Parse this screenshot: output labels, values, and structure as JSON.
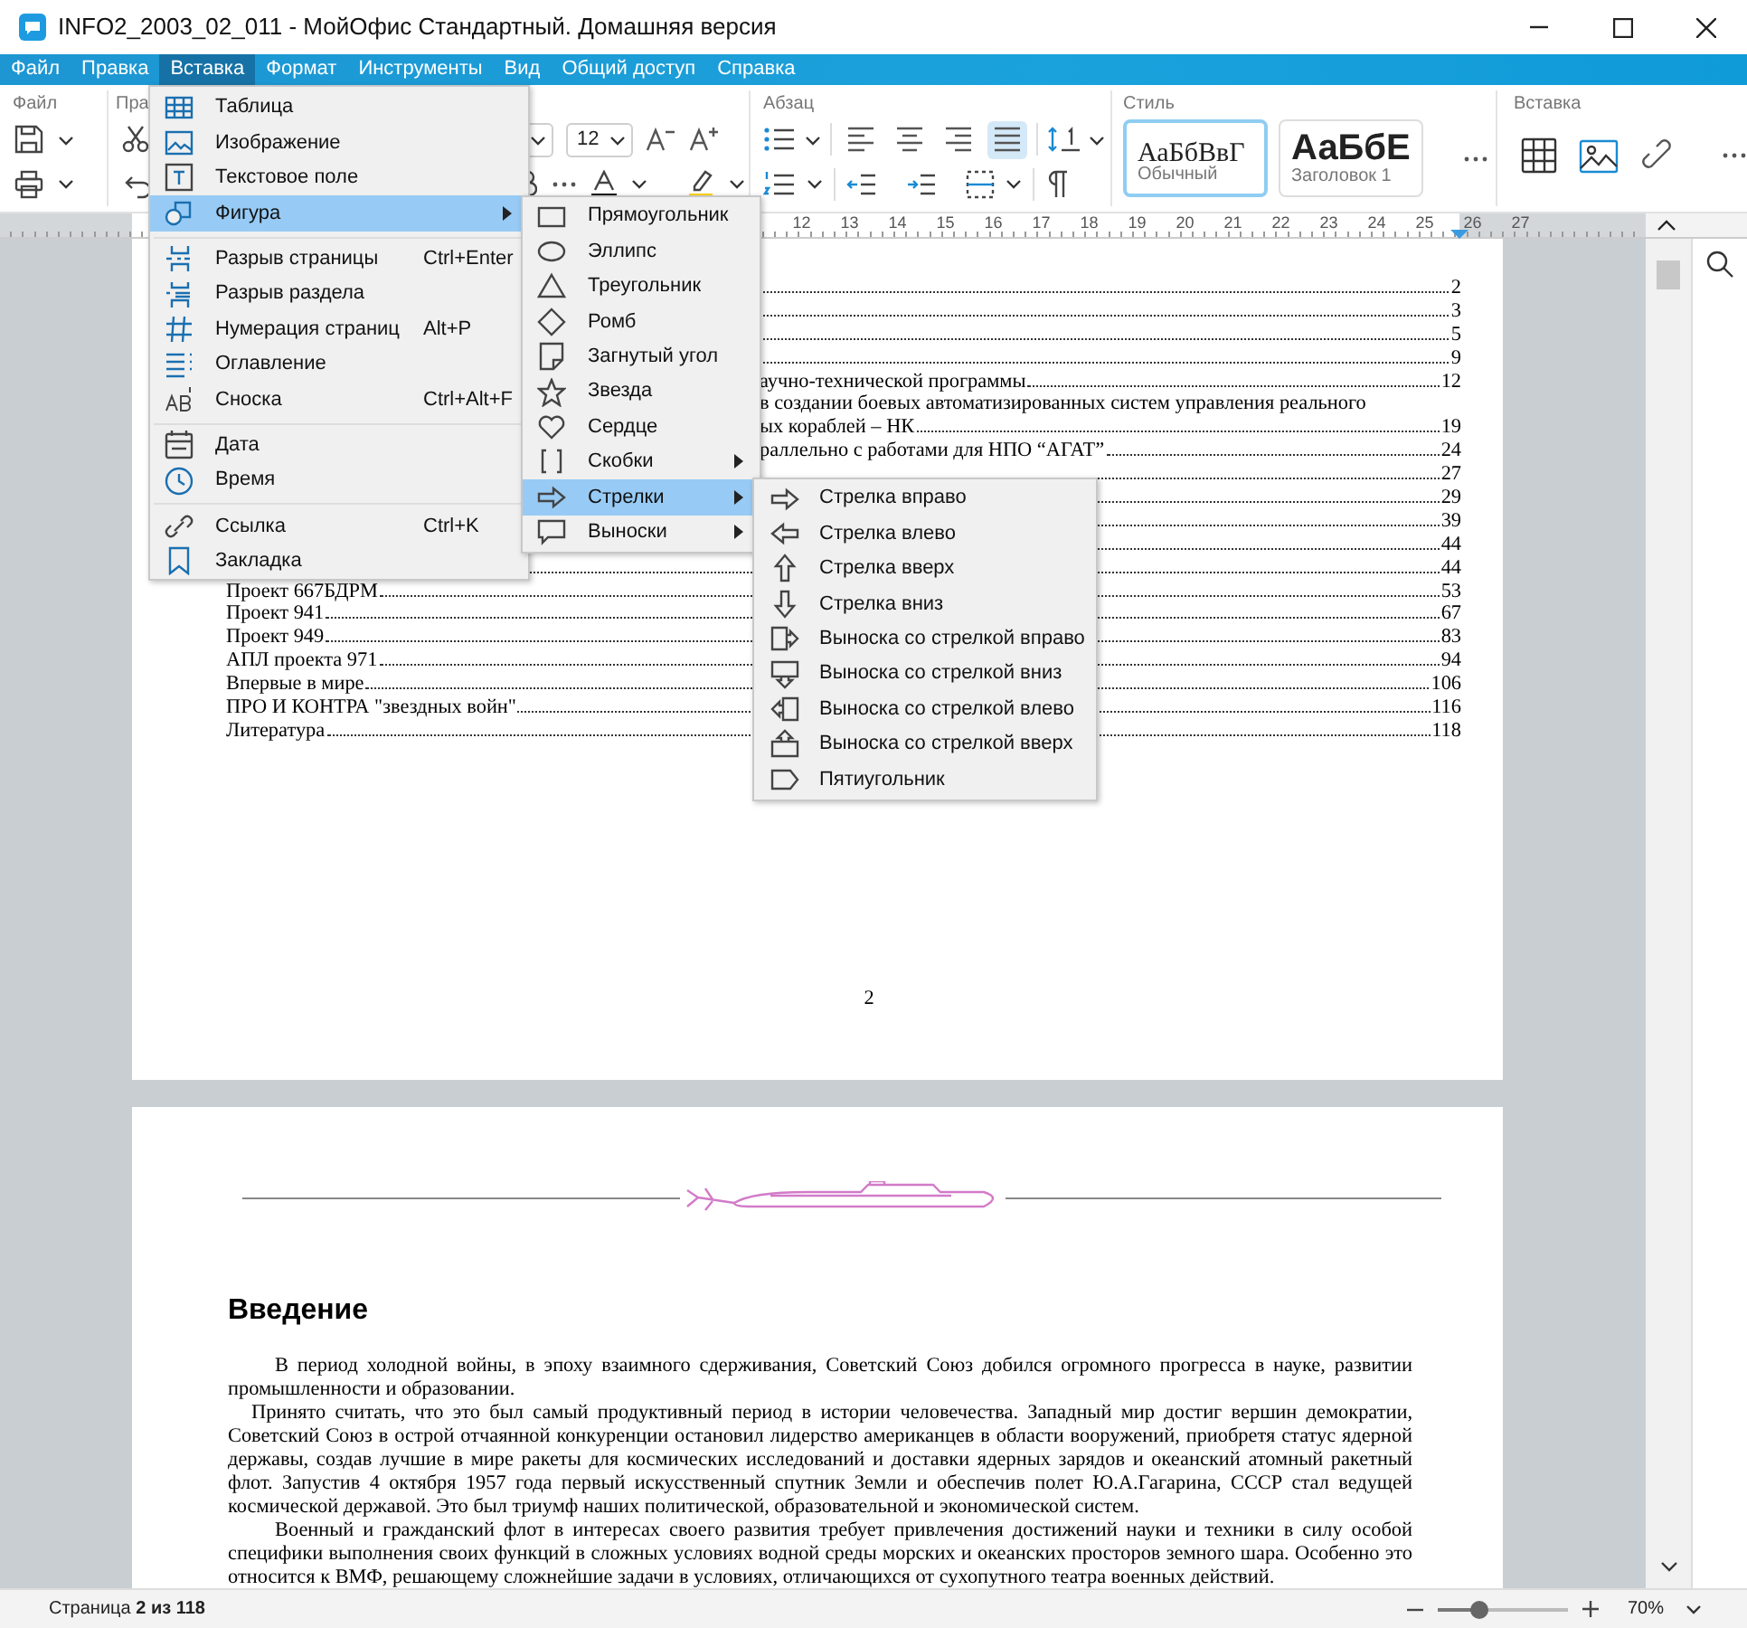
{
  "window": {
    "title": "INFO2_2003_02_011 - МойОфис Стандартный. Домашняя версия"
  },
  "menu_bar": [
    {
      "label": "Файл",
      "selected": false
    },
    {
      "label": "Правка",
      "selected": false
    },
    {
      "label": "Вставка",
      "selected": true
    },
    {
      "label": "Формат",
      "selected": false
    },
    {
      "label": "Инструменты",
      "selected": false
    },
    {
      "label": "Вид",
      "selected": false
    },
    {
      "label": "Общий доступ",
      "selected": false
    },
    {
      "label": "Справка",
      "selected": false
    }
  ],
  "ribbon": {
    "file_label": "Файл",
    "edit_label": "Пра",
    "font_size": "12",
    "paragraph_label": "Абзац",
    "alignment": [
      {
        "selected": false
      },
      {
        "selected": false
      },
      {
        "selected": false
      },
      {
        "selected": true
      }
    ],
    "style_label": "Стиль",
    "styles": [
      {
        "kind": "normal",
        "sample": "АаБбВвГ",
        "name": "Обычный",
        "selected": true
      },
      {
        "kind": "heading",
        "sample": "АаБбЕ",
        "name": "Заголовок 1",
        "selected": false
      }
    ],
    "insert_label": "Вставка"
  },
  "ruler": {
    "numbers": [
      "12",
      "13",
      "14",
      "15",
      "16",
      "17",
      "18",
      "19",
      "20",
      "21",
      "22",
      "23",
      "24",
      "25",
      "26",
      "27"
    ]
  },
  "document": {
    "toc": [
      {
        "kind": "covered",
        "page": "2"
      },
      {
        "kind": "covered",
        "page": "3"
      },
      {
        "kind": "covered",
        "page": "5"
      },
      {
        "kind": "covered",
        "page": "9"
      },
      {
        "kind": "partial",
        "text": "аучно-технической программы",
        "page": "12"
      },
      {
        "kind": "partial",
        "text": "в создании боевых автоматизированных систем управления  реального"
      },
      {
        "kind": "partial",
        "text": "ых кораблей – НК",
        "page": "19"
      },
      {
        "kind": "partial",
        "text": "раллельно с работами для НПО “АГАТ”",
        "page": "24"
      },
      {
        "kind": "covered",
        "page": "27"
      },
      {
        "kind": "covered",
        "page": "29"
      },
      {
        "kind": "covered",
        "page": "39"
      },
      {
        "kind": "covered",
        "page": "44"
      },
      {
        "kind": "covered",
        "page": "44"
      },
      {
        "kind": "full",
        "text": "Проект 667БДРМ",
        "page": "53"
      },
      {
        "kind": "full",
        "text": "Проект 941",
        "page": "67"
      },
      {
        "kind": "full",
        "text": "Проект 949",
        "page": "83"
      },
      {
        "kind": "full",
        "text": "АПЛ проекта 971",
        "page": "94"
      },
      {
        "kind": "full",
        "text": "Впервые в мире",
        "page": "106"
      },
      {
        "kind": "full",
        "text": "ПРО И КОНТРА \"звездных войн\"",
        "page": "116"
      },
      {
        "kind": "full",
        "text": "Литература",
        "page": "118"
      }
    ],
    "page_number": "2",
    "heading": "Введение",
    "paragraphs": [
      {
        "kind": "indent",
        "text": "В период холодной войны, в эпоху взаимного сдерживания, Советский Союз добился огромного прогресса в науке, развитии промышленности и образовании."
      },
      {
        "kind": "short_indent",
        "text": "Принято считать, что это был самый продуктивный период в истории человечества. Западный мир достиг вершин демократии, Советский Союз в острой отчаянной конкуренции остановил лидерство американцев в области вооружений, приобретя статус ядерной державы, создав лучшие в мире ракеты для космических исследований и доставки ядерных зарядов и океанский атомный ракетный флот. Запустив 4 октября 1957 года первый искусственный спутник Земли и обеспечив полет Ю.А.Гагарина, СССР стал ведущей космической державой. Это был триумф наших политической, образовательной и экономической систем."
      },
      {
        "kind": "indent",
        "text": "Военный и гражданский флот в интересах своего развития требует привлечения достижений науки и техники в силу особой специфики выполнения своих функций в сложных условиях водной среды морских и океанских просторов земного шара. Особенно это относится к ВМФ, решающему сложнейшие задачи в условиях, отличающихся от сухопутного театра военных действий."
      }
    ]
  },
  "insert_menu": {
    "items": [
      {
        "kind": "item",
        "label": "Таблица",
        "selected": false,
        "submenu": false
      },
      {
        "kind": "item",
        "label": "Изображение",
        "selected": false,
        "submenu": false
      },
      {
        "kind": "item",
        "label": "Текстовое поле",
        "selected": false,
        "submenu": false
      },
      {
        "kind": "item",
        "label": "Фигура",
        "selected": true,
        "submenu": true
      },
      {
        "kind": "separator"
      },
      {
        "kind": "item",
        "label": "Разрыв страницы",
        "shortcut": "Ctrl+Enter",
        "selected": false,
        "submenu": false
      },
      {
        "kind": "item",
        "label": "Разрыв раздела",
        "selected": false,
        "submenu": false
      },
      {
        "kind": "item",
        "label": "Нумерация страниц",
        "shortcut": "Alt+P",
        "selected": false,
        "submenu": false
      },
      {
        "kind": "item",
        "label": "Оглавление",
        "selected": false,
        "submenu": false
      },
      {
        "kind": "item",
        "label": "Сноска",
        "shortcut": "Ctrl+Alt+F",
        "selected": false,
        "submenu": false
      },
      {
        "kind": "separator"
      },
      {
        "kind": "item",
        "label": "Дата",
        "selected": false,
        "submenu": false
      },
      {
        "kind": "item",
        "label": "Время",
        "selected": false,
        "submenu": false
      },
      {
        "kind": "separator"
      },
      {
        "kind": "item",
        "label": "Ссылка",
        "shortcut": "Ctrl+K",
        "selected": false,
        "submenu": false
      },
      {
        "kind": "item",
        "label": "Закладка",
        "selected": false,
        "submenu": false
      }
    ]
  },
  "shape_submenu": {
    "items": [
      {
        "kind": "item",
        "label": "Прямоугольник",
        "selected": false,
        "submenu": false
      },
      {
        "kind": "item",
        "label": "Эллипс",
        "selected": false,
        "submenu": false
      },
      {
        "kind": "item",
        "label": "Треугольник",
        "selected": false,
        "submenu": false
      },
      {
        "kind": "item",
        "label": "Ромб",
        "selected": false,
        "submenu": false
      },
      {
        "kind": "item",
        "label": "Загнутый угол",
        "selected": false,
        "submenu": false
      },
      {
        "kind": "item",
        "label": "Звезда",
        "selected": false,
        "submenu": false
      },
      {
        "kind": "item",
        "label": "Сердце",
        "selected": false,
        "submenu": false
      },
      {
        "kind": "item",
        "label": "Скобки",
        "selected": false,
        "submenu": true
      },
      {
        "kind": "item",
        "label": "Стрелки",
        "selected": true,
        "submenu": true
      },
      {
        "kind": "item",
        "label": "Выноски",
        "selected": false,
        "submenu": true
      }
    ]
  },
  "arrow_submenu": {
    "items": [
      {
        "kind": "item",
        "label": "Стрелка вправо",
        "selected": false,
        "submenu": false
      },
      {
        "kind": "item",
        "label": "Стрелка влево",
        "selected": false,
        "submenu": false
      },
      {
        "kind": "item",
        "label": "Стрелка вверх",
        "selected": false,
        "submenu": false
      },
      {
        "kind": "item",
        "label": "Стрелка вниз",
        "selected": false,
        "submenu": false
      },
      {
        "kind": "item",
        "label": "Выноска со стрелкой вправо",
        "selected": false,
        "submenu": false
      },
      {
        "kind": "item",
        "label": "Выноска со стрелкой вниз",
        "selected": false,
        "submenu": false
      },
      {
        "kind": "item",
        "label": "Выноска со стрелкой влево",
        "selected": false,
        "submenu": false
      },
      {
        "kind": "item",
        "label": "Выноска со стрелкой вверх",
        "selected": false,
        "submenu": false
      },
      {
        "kind": "item",
        "label": "Пятиугольник",
        "selected": false,
        "submenu": false
      }
    ]
  },
  "status_bar": {
    "page": "Страница **2 из 118**",
    "zoom": {
      "level": 0.32
    },
    "zoom_value": "70%"
  }
}
